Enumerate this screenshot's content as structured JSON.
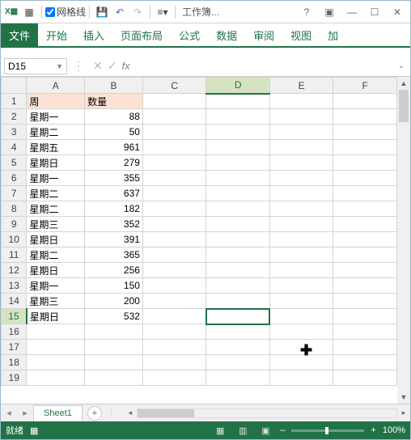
{
  "titlebar": {
    "gridlines_label": "网格线",
    "workbook_title": "工作簿..."
  },
  "ribbon": {
    "tabs": [
      "文件",
      "开始",
      "插入",
      "页面布局",
      "公式",
      "数据",
      "审阅",
      "视图",
      "加"
    ]
  },
  "name_box": "D15",
  "columns": [
    "A",
    "B",
    "C",
    "D",
    "E",
    "F"
  ],
  "headers": {
    "col_a": "周",
    "col_b": "数量"
  },
  "rows": [
    {
      "a": "星期一",
      "b": 88
    },
    {
      "a": "星期二",
      "b": 50
    },
    {
      "a": "星期五",
      "b": 961
    },
    {
      "a": "星期日",
      "b": 279
    },
    {
      "a": "星期一",
      "b": 355
    },
    {
      "a": "星期二",
      "b": 637
    },
    {
      "a": "星期二",
      "b": 182
    },
    {
      "a": "星期三",
      "b": 352
    },
    {
      "a": "星期日",
      "b": 391
    },
    {
      "a": "星期二",
      "b": 365
    },
    {
      "a": "星期日",
      "b": 256
    },
    {
      "a": "星期一",
      "b": 150
    },
    {
      "a": "星期三",
      "b": 200
    },
    {
      "a": "星期日",
      "b": 532
    }
  ],
  "active_cell": {
    "col": "D",
    "row": 15
  },
  "sheet_tab": "Sheet1",
  "status": {
    "ready": "就绪",
    "zoom": "100%"
  }
}
